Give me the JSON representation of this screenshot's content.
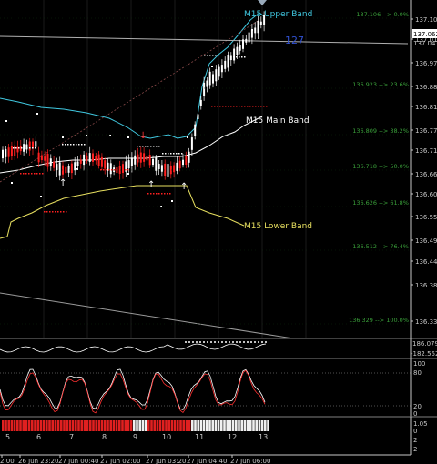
{
  "colors": {
    "background": "#000000",
    "upper_band": "#40c8e0",
    "main_band": "#ffffff",
    "lower_band": "#e8e060",
    "fib": "#3aa03a",
    "buy": "#ff2020",
    "sell": "#ffffff",
    "axis_text": "#c8c8c8",
    "price_line": "#b0b0b0",
    "label_blue": "#3050d0",
    "stoch_red": "#ff3030",
    "stoch_white": "#ffffff"
  },
  "price_axis": {
    "ticks": [
      "137.100",
      "137.010",
      "136.970",
      "136.880",
      "136.810",
      "136.770",
      "136.710",
      "136.660",
      "136.600",
      "136.550",
      "136.490",
      "136.440",
      "136.380",
      "136.330"
    ],
    "current": "137.062",
    "current2": "137.043"
  },
  "labels": {
    "upper_band": "M15 Upper Band",
    "main_band": "M15 Main Band",
    "lower_band": "M15 Lower Band",
    "marker": "127"
  },
  "fib_levels": [
    {
      "text": "137.106 --> 0.0%"
    },
    {
      "text": "136.923 --> 23.6%"
    },
    {
      "text": "136.809 --> 38.2%"
    },
    {
      "text": "136.718 --> 50.0%"
    },
    {
      "text": "136.626 --> 61.8%"
    },
    {
      "text": "136.512 --> 76.4%"
    },
    {
      "text": "136.329 --> 100.0%"
    }
  ],
  "sub1": {
    "top": "186.079",
    "bottom": "-182.552"
  },
  "sub2": {
    "top": "100",
    "mid": "80",
    "low": "20",
    "bottom": "0"
  },
  "sub3": {
    "top": "1.05",
    "bottom": "0"
  },
  "sub3_extra": [
    "2",
    "2"
  ],
  "bar_numbers": [
    "5",
    "6",
    "7",
    "8",
    "9",
    "10",
    "11",
    "12",
    "13"
  ],
  "time_axis": [
    "2:00",
    "26 Jun 23:20",
    "27 Jun 00:40",
    "27 Jun 02:00",
    "27 Jun 03:20",
    "27 Jun 04:40",
    "27 Jun 06:00"
  ]
}
